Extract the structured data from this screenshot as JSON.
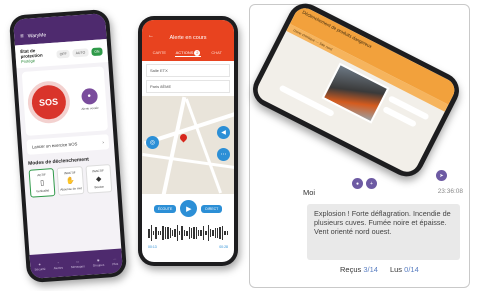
{
  "phone_left": {
    "app_name": "WaryMe",
    "state_label": "État de protection",
    "state_value": "Protégé",
    "toggle_off": "OFF",
    "toggle_auto": "AUTO",
    "toggle_on": "ON",
    "sos_label": "SOS",
    "voice_label": "Alerte vocale",
    "exercise_label": "Lancer un exercice SOS",
    "modes_title": "Modes de déclenchement",
    "modes": [
      {
        "label": "Verticalité",
        "badge": "ACTIF",
        "icon": "phone-tilt-icon"
      },
      {
        "label": "Absence de mvt",
        "badge": "INACTIF",
        "icon": "hand-icon"
      },
      {
        "label": "Bouton",
        "badge": "INACTIF",
        "icon": "shield-icon"
      }
    ],
    "tabs": [
      "Sécurité",
      "Alertes",
      "Messages",
      "Groupes",
      "Plus"
    ]
  },
  "phone_middle": {
    "title": "Alerte en cours",
    "tabs": [
      "CARTE",
      "ACTIONS",
      "CHAT"
    ],
    "actions_badge": "2",
    "field_1": "Salle ETX",
    "field_2": "Paris 8ÈME",
    "btn_left": "ÉCOUTE",
    "btn_right": "DIRECT",
    "time_start": "00:13",
    "time_end": "00:28"
  },
  "phone_right": {
    "header": "Déclenchement de produits dangereux",
    "subheader": "Usine chimique — Site nord"
  },
  "message": {
    "sender": "Moi",
    "time": "23:36:08",
    "text": "Explosion ! Forte déflagration. Incendie de plusieurs cuves. Fumée noire et épaisse. Vent orienté nord ouest.",
    "received_label": "Reçus",
    "received_value": "3/14",
    "read_label": "Lus",
    "read_value": "0/14"
  },
  "colors": {
    "purple": "#4e2a6e",
    "red": "#d9342b",
    "orange": "#e8431f",
    "blue": "#2c8fd6",
    "amber": "#f2a13c"
  }
}
